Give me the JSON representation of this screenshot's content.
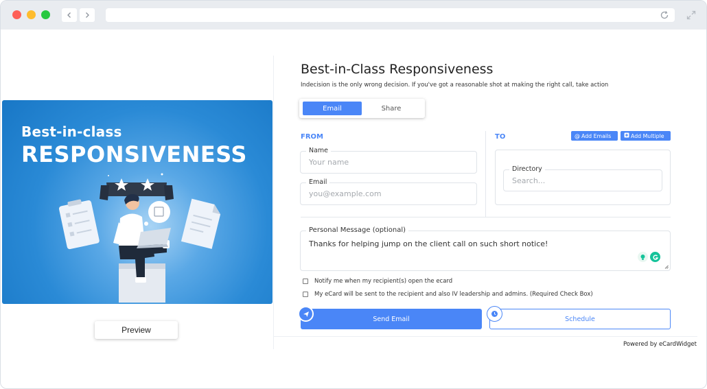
{
  "browser": {
    "url": ""
  },
  "hero": {
    "line1": "Best-in-class",
    "line2": "RESPONSIVENESS"
  },
  "preview": {
    "label": "Preview"
  },
  "form": {
    "title": "Best-in-Class Responsiveness",
    "subtitle": "Indecision is the only wrong decision. If you've got a reasonable shot at making the right call, take action",
    "tabs": [
      {
        "label": "Email",
        "active": true
      },
      {
        "label": "Share",
        "active": false
      }
    ],
    "from": {
      "label": "FROM",
      "name_label": "Name",
      "name_placeholder": "Your name",
      "email_label": "Email",
      "email_placeholder": "you@example.com"
    },
    "to": {
      "label": "TO",
      "add_emails": "Add Emails",
      "add_multiple": "Add Multiple",
      "directory_label": "Directory",
      "directory_placeholder": "Search..."
    },
    "message": {
      "label": "Personal Message (optional)",
      "value": "Thanks for helping jump on the client call on such short notice!"
    },
    "checks": [
      {
        "label": "Notify me when my recipient(s) open the ecard",
        "checked": false
      },
      {
        "label": "My eCard will be sent to the recipient and also IV leadership and admins. (Required Check Box)",
        "checked": false
      }
    ],
    "send_label": "Send Email",
    "schedule_label": "Schedule",
    "powered_by": "Powered by eCardWidget"
  },
  "colors": {
    "accent": "#4a86f7",
    "hero_blue": "#1877c6"
  }
}
